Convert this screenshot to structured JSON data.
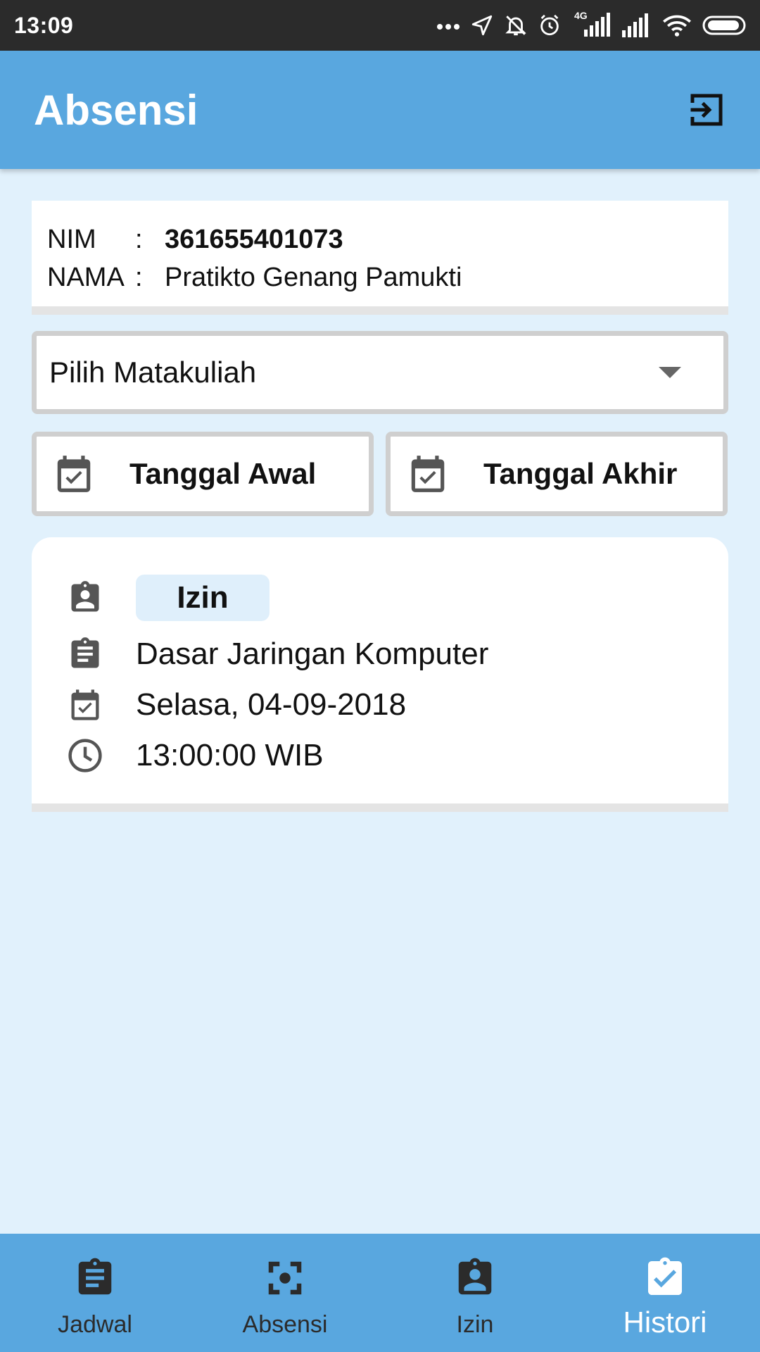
{
  "status_bar": {
    "time": "13:09",
    "network": "4G"
  },
  "app_bar": {
    "title": "Absensi",
    "logout_icon": "logout-icon"
  },
  "student": {
    "nim_label": "NIM",
    "nim_colon": ":",
    "nim_value": "361655401073",
    "name_label": "NAMA",
    "name_colon": ":",
    "name_value": "Pratikto Genang Pamukti"
  },
  "filter": {
    "course_select": "Pilih Matakuliah",
    "start_date": "Tanggal Awal",
    "end_date": "Tanggal Akhir"
  },
  "history": [
    {
      "status": "Izin",
      "course": "Dasar Jaringan Komputer",
      "date": "Selasa, 04-09-2018",
      "time": "13:00:00 WIB"
    }
  ],
  "bottom_nav": {
    "items": [
      {
        "label": "Jadwal",
        "icon": "clipboard-list-icon",
        "active": false
      },
      {
        "label": "Absensi",
        "icon": "scan-icon",
        "active": false
      },
      {
        "label": "Izin",
        "icon": "badge-person-icon",
        "active": false
      },
      {
        "label": "Histori",
        "icon": "clipboard-check-icon",
        "active": true
      }
    ]
  },
  "colors": {
    "primary": "#59a7df",
    "background": "#e1f1fc",
    "status_bar": "#2b2b2b",
    "badge": "#dfeffb",
    "icon_gray": "#555555"
  }
}
